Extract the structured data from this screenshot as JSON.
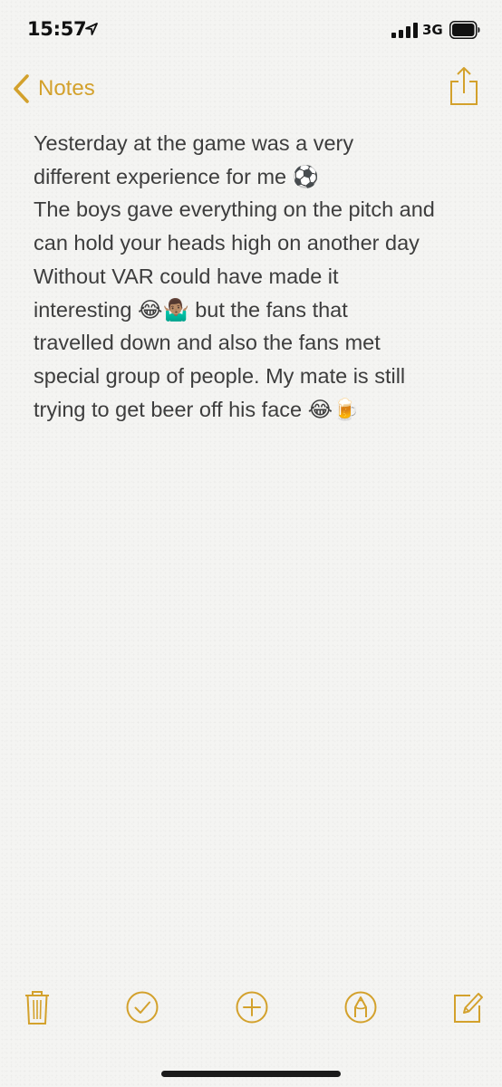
{
  "status_bar": {
    "time": "15:57",
    "network": "3G",
    "icons": {
      "location": "location-arrow-icon",
      "signal": "cellular-signal-icon",
      "battery": "battery-icon"
    }
  },
  "nav": {
    "back_label": "Notes",
    "back_icon": "chevron-left-icon",
    "share_icon": "share-icon"
  },
  "accent_color": "#d3a12c",
  "note": {
    "lines": [
      "Yesterday at the game was a very",
      "different experience for me",
      "The boys gave everything on the pitch and",
      "can hold your heads high on another day",
      "Without VAR could have made it",
      "interesting",
      "travelled down and also the fans met",
      "special group of people. My mate is still",
      "trying to get beer off his face"
    ],
    "emoji": {
      "soccer": "⚽",
      "laughing": "😂",
      "shrug": "🤷🏽‍♂️",
      "beer": "🍺"
    },
    "line6_suffix": " but the fans that"
  },
  "toolbar": {
    "icons": [
      "trash-icon",
      "checklist-icon",
      "add-icon",
      "markup-icon",
      "compose-icon"
    ]
  }
}
